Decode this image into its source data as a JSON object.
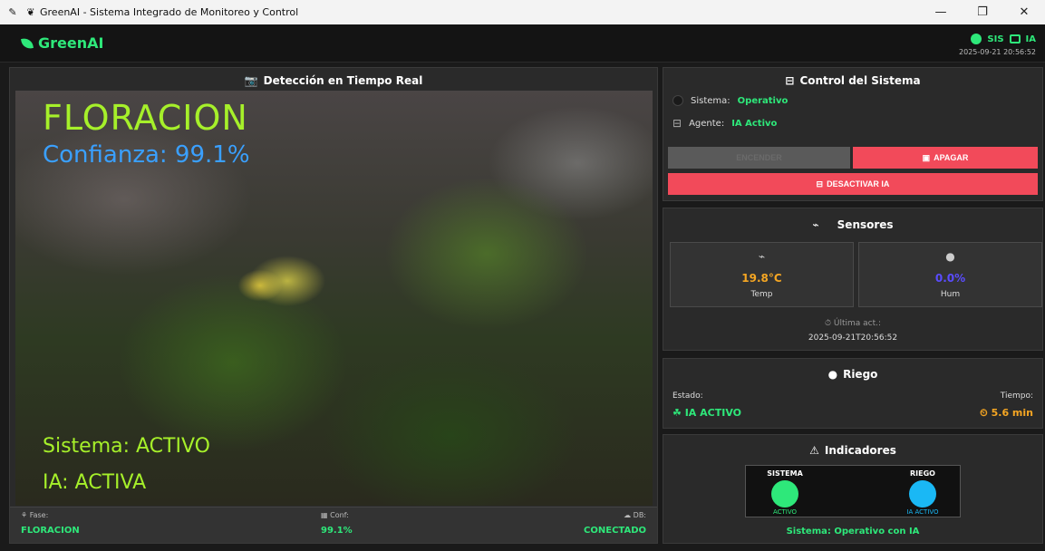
{
  "window": {
    "title": "GreenAI - Sistema Integrado de Monitoreo y Control",
    "controls": {
      "minimize": "—",
      "maximize": "❐",
      "close": "✕"
    }
  },
  "header": {
    "brand": "GreenAI",
    "status_sis": "SIS",
    "status_ia": "IA",
    "timestamp": "2025-09-21 20:56:52"
  },
  "camera": {
    "title": "Detección en Tiempo Real",
    "overlay_phase": "FLORACION",
    "overlay_confidence": "Confianza: 99.1%",
    "overlay_system": "Sistema: ACTIVO",
    "overlay_ia": "IA: ACTIVA",
    "footer": {
      "fase_label": "Fase:",
      "fase_value": "FLORACION",
      "conf_label": "Conf:",
      "conf_value": "99.1%",
      "db_label": "DB:",
      "db_value": "CONECTADO"
    }
  },
  "control": {
    "title": "Control del Sistema",
    "sistema_label": "Sistema:",
    "sistema_value": "Operativo",
    "agente_label": "Agente:",
    "agente_value": "IA Activo",
    "btn_encender": "ENCENDER",
    "btn_apagar": "APAGAR",
    "btn_desactivar": "DESACTIVAR IA"
  },
  "sensores": {
    "title": "Sensores",
    "temp_value": "19.8°C",
    "temp_label": "Temp",
    "hum_value": "0.0%",
    "hum_label": "Hum",
    "last_update_label": "Última act.:",
    "last_update_value": "2025-09-21T20:56:52"
  },
  "riego": {
    "title": "Riego",
    "estado_label": "Estado:",
    "tiempo_label": "Tiempo:",
    "estado_value": "IA ACTIVO",
    "tiempo_value": "5.6 min"
  },
  "indicadores": {
    "title": "Indicadores",
    "sistema_label": "SISTEMA",
    "sistema_state": "ACTIVO",
    "riego_label": "RIEGO",
    "riego_state": "IA ACTIVO",
    "status_text": "Sistema: Operativo con IA"
  },
  "colors": {
    "accent_green": "#2ee87a",
    "accent_blue": "#1ab8f5",
    "danger_red": "#f24a5a",
    "warning_orange": "#f5a623",
    "temp_color": "#f5a623",
    "hum_color": "#5a4cff"
  }
}
